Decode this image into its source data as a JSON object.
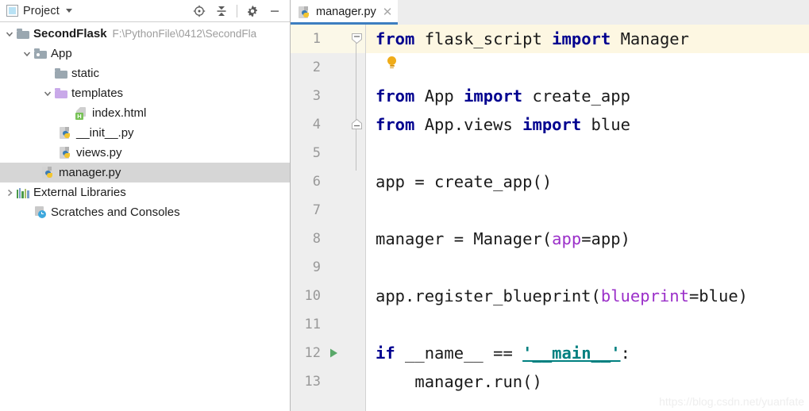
{
  "panel": {
    "title": "Project",
    "icon": "project-icon",
    "dropdown_icon": "chevron-down-icon",
    "tools": [
      {
        "name": "locate-icon",
        "label": "Select Opened File"
      },
      {
        "name": "collapse-all-icon",
        "label": "Collapse All"
      },
      {
        "name": "gear-icon",
        "label": "Settings"
      },
      {
        "name": "minimize-icon",
        "label": "Hide"
      }
    ]
  },
  "tree": {
    "items": [
      {
        "label": "SecondFlask",
        "path": "F:\\PythonFile\\0412\\SecondFla",
        "icon": "folder-gray-icon",
        "arrow": "expanded",
        "indent": 0,
        "bold": true,
        "selected": false
      },
      {
        "label": "App",
        "path": "",
        "icon": "folder-source-root-icon",
        "arrow": "expanded",
        "indent": 1,
        "bold": false,
        "selected": false
      },
      {
        "label": "static",
        "path": "",
        "icon": "folder-gray-icon",
        "arrow": "none",
        "indent": 2,
        "bold": false,
        "selected": false
      },
      {
        "label": "templates",
        "path": "",
        "icon": "folder-template-root-icon",
        "arrow": "expanded",
        "indent": 2,
        "bold": false,
        "selected": false
      },
      {
        "label": "index.html",
        "path": "",
        "icon": "html-file-icon",
        "arrow": "none",
        "indent": 3,
        "bold": false,
        "selected": false
      },
      {
        "label": "__init__.py",
        "path": "",
        "icon": "python-file-icon",
        "arrow": "none",
        "indent": 2,
        "bold": false,
        "selected": false
      },
      {
        "label": "views.py",
        "path": "",
        "icon": "python-file-icon",
        "arrow": "none",
        "indent": 2,
        "bold": false,
        "selected": false
      },
      {
        "label": "manager.py",
        "path": "",
        "icon": "python-file-icon",
        "arrow": "none",
        "indent": 1,
        "bold": false,
        "selected": true
      },
      {
        "label": "External Libraries",
        "path": "",
        "icon": "external-libraries-icon",
        "arrow": "collapsed",
        "indent": 0,
        "bold": false,
        "selected": false
      },
      {
        "label": "Scratches and Consoles",
        "path": "",
        "icon": "scratches-icon",
        "arrow": "none",
        "indent": 0,
        "bold": false,
        "selected": false
      }
    ]
  },
  "editor": {
    "tab": {
      "label": "manager.py",
      "icon": "python-file-icon",
      "close_icon": "close-icon",
      "active": true
    },
    "line_numbers": [
      "1",
      "2",
      "3",
      "4",
      "5",
      "6",
      "7",
      "8",
      "9",
      "10",
      "11",
      "12",
      "13"
    ],
    "highlighted_line": 1,
    "run_marker_line": 12,
    "intention_bulb_line": 2,
    "fold_marker_lines": [
      1,
      4
    ],
    "lines": [
      {
        "n": 1,
        "tokens": [
          {
            "t": "from",
            "c": "kw"
          },
          {
            "t": " flask_script ",
            "c": "plain"
          },
          {
            "t": "import",
            "c": "kw"
          },
          {
            "t": " Manager",
            "c": "plain"
          }
        ]
      },
      {
        "n": 2,
        "tokens": []
      },
      {
        "n": 3,
        "tokens": [
          {
            "t": "from",
            "c": "kw"
          },
          {
            "t": " App ",
            "c": "plain"
          },
          {
            "t": "import",
            "c": "kw"
          },
          {
            "t": " create_app",
            "c": "plain"
          }
        ]
      },
      {
        "n": 4,
        "tokens": [
          {
            "t": "from",
            "c": "kw"
          },
          {
            "t": " App.views ",
            "c": "plain"
          },
          {
            "t": "import",
            "c": "kw"
          },
          {
            "t": " blue",
            "c": "plain"
          }
        ]
      },
      {
        "n": 5,
        "tokens": []
      },
      {
        "n": 6,
        "tokens": [
          {
            "t": "app = create_app()",
            "c": "plain"
          }
        ]
      },
      {
        "n": 7,
        "tokens": []
      },
      {
        "n": 8,
        "tokens": [
          {
            "t": "manager = Manager(",
            "c": "plain"
          },
          {
            "t": "app",
            "c": "kwarg"
          },
          {
            "t": "=app)",
            "c": "plain"
          }
        ]
      },
      {
        "n": 9,
        "tokens": []
      },
      {
        "n": 10,
        "tokens": [
          {
            "t": "app.register_blueprint(",
            "c": "plain"
          },
          {
            "t": "blueprint",
            "c": "kwarg"
          },
          {
            "t": "=blue)",
            "c": "plain"
          }
        ]
      },
      {
        "n": 11,
        "tokens": []
      },
      {
        "n": 12,
        "tokens": [
          {
            "t": "if",
            "c": "kw"
          },
          {
            "t": " __name__ == ",
            "c": "plain"
          },
          {
            "t": "'__main__'",
            "c": "str"
          },
          {
            "t": ":",
            "c": "plain"
          }
        ]
      },
      {
        "n": 13,
        "tokens": [
          {
            "t": "    manager.run()",
            "c": "plain"
          }
        ]
      }
    ]
  },
  "watermark": "https://blog.csdn.net/yuanfate",
  "colors": {
    "keyword": "#00008f",
    "kwarg": "#9b30c9",
    "string": "#008080",
    "tab_underline": "#3d7ec0",
    "selection": "#d6d6d6",
    "highlight_row": "#fdf7e2",
    "gutter": "#eeeeee",
    "run_arrow": "#59a869",
    "bulb": "#f0ac19"
  }
}
